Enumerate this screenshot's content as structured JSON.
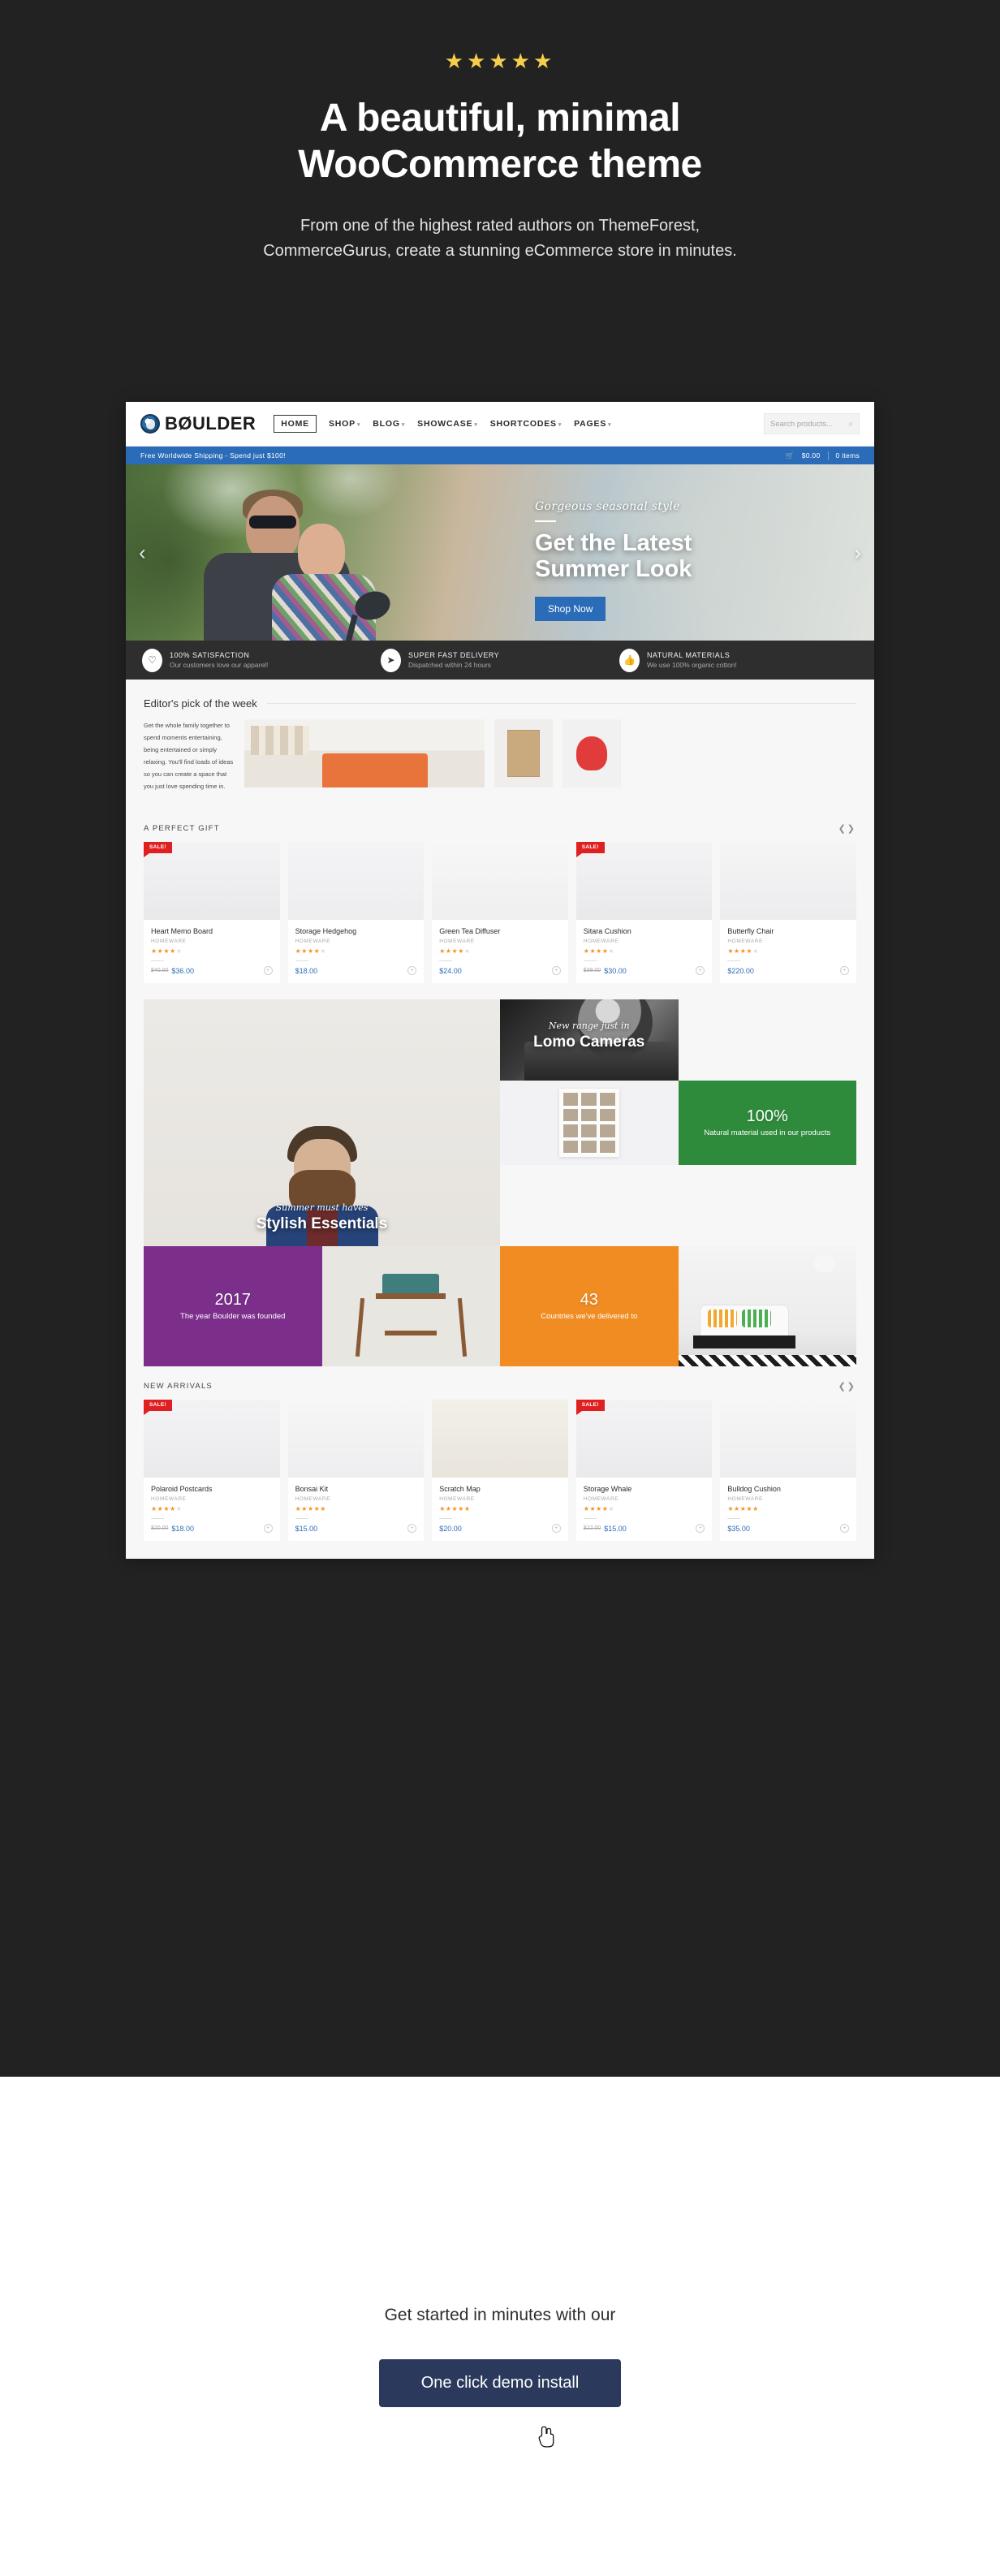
{
  "promo": {
    "stars": "★★★★★",
    "title_line1": "A beautiful, minimal",
    "title_line2": "WooCommerce theme",
    "sub_line1": "From one of the highest rated authors on ThemeForest,",
    "sub_line2": "CommerceGurus, create a stunning eCommerce store in minutes."
  },
  "site": {
    "logo_text": "BØULDER",
    "nav": [
      {
        "label": "HOME",
        "caret": "",
        "active": true
      },
      {
        "label": "SHOP",
        "caret": "▾",
        "active": false
      },
      {
        "label": "BLOG",
        "caret": "▾",
        "active": false
      },
      {
        "label": "SHOWCASE",
        "caret": "▾",
        "active": false
      },
      {
        "label": "SHORTCODES",
        "caret": "▾",
        "active": false
      },
      {
        "label": "PAGES",
        "caret": "▾",
        "active": false
      }
    ],
    "search_placeholder": "Search products...",
    "search_icon": "⌕",
    "shipping": {
      "message": "Free Worldwide Shipping - Spend just $100!",
      "cart_icon": "🛒",
      "cart_total": "$0.00",
      "cart_items": "0 items"
    },
    "hero": {
      "script": "Gorgeous seasonal style",
      "headline_line1": "Get the Latest",
      "headline_line2": "Summer Look",
      "button": "Shop Now",
      "prev": "‹",
      "next": "›"
    },
    "features": [
      {
        "icon": "♡",
        "title": "100% SATISFACTION",
        "sub": "Our customers love our apparel!"
      },
      {
        "icon": "➤",
        "title": "SUPER FAST DELIVERY",
        "sub": "Dispatched within 24 hours"
      },
      {
        "icon": "👍",
        "title": "NATURAL MATERIALS",
        "sub": "We use 100% organic cotton!"
      }
    ],
    "editor": {
      "title": "Editor's pick of the week",
      "copy": "Get the whole family together to spend moments entertaining, being entertained or simply relaxing. You'll find loads of ideas so you can create a space that you just love spending time in."
    },
    "perfect_gift": {
      "title": "A PERFECT GIFT",
      "prev": "❮",
      "next": "❯",
      "products": [
        {
          "name": "Heart Memo Board",
          "cat": "HOMEWARE",
          "stars": 4,
          "price_old": "$40.00",
          "price": "$36.00",
          "sale": true
        },
        {
          "name": "Storage Hedgehog",
          "cat": "HOMEWARE",
          "stars": 4,
          "price_old": "",
          "price": "$18.00",
          "sale": false
        },
        {
          "name": "Green Tea Diffuser",
          "cat": "HOMEWARE",
          "stars": 4,
          "price_old": "",
          "price": "$24.00",
          "sale": false
        },
        {
          "name": "Sitara Cushion",
          "cat": "HOMEWARE",
          "stars": 4,
          "price_old": "$38.00",
          "price": "$30.00",
          "sale": true
        },
        {
          "name": "Butterfly Chair",
          "cat": "HOMEWARE",
          "stars": 4,
          "price_old": "",
          "price": "$220.00",
          "sale": false
        }
      ]
    },
    "mosaic": {
      "essentials_script": "Summer must haves",
      "essentials_title": "Stylish Essentials",
      "cameras_script": "New range just in",
      "cameras_title": "Lomo Cameras",
      "stat_natural_num": "100%",
      "stat_natural_label": "Natural material used in our products",
      "stat_year_num": "2017",
      "stat_year_label": "The year Boulder was founded",
      "stat_countries_num": "43",
      "stat_countries_label": "Countries we've delivered to"
    },
    "new_arrivals": {
      "title": "NEW ARRIVALS",
      "prev": "❮",
      "next": "❯",
      "products": [
        {
          "name": "Polaroid Postcards",
          "cat": "HOMEWARE",
          "stars": 4,
          "price_old": "$20.00",
          "price": "$18.00",
          "sale": true
        },
        {
          "name": "Bonsai Kit",
          "cat": "HOMEWARE",
          "stars": 5,
          "price_old": "",
          "price": "$15.00",
          "sale": false
        },
        {
          "name": "Scratch Map",
          "cat": "HOMEWARE",
          "stars": 5,
          "price_old": "",
          "price": "$20.00",
          "sale": false
        },
        {
          "name": "Storage Whale",
          "cat": "HOMEWARE",
          "stars": 4,
          "price_old": "$22.00",
          "price": "$15.00",
          "sale": true
        },
        {
          "name": "Bulldog Cushion",
          "cat": "HOMEWARE",
          "stars": 5,
          "price_old": "",
          "price": "$35.00",
          "sale": false
        }
      ]
    },
    "sale_label": "SALE!",
    "cart_plus": "+"
  },
  "cta": {
    "text": "Get started in minutes with our",
    "button": "One click demo install"
  },
  "colors": {
    "dark_bg": "#222222",
    "accent_blue": "#2b6cb8",
    "star_gold": "#f5cf4b",
    "rating_orange": "#f0932b",
    "sale_red": "#e02020",
    "green_tile": "#2e8b3c",
    "purple_tile": "#7b2f8b",
    "orange_tile": "#f08c22",
    "cta_navy": "#2b3a5c"
  }
}
